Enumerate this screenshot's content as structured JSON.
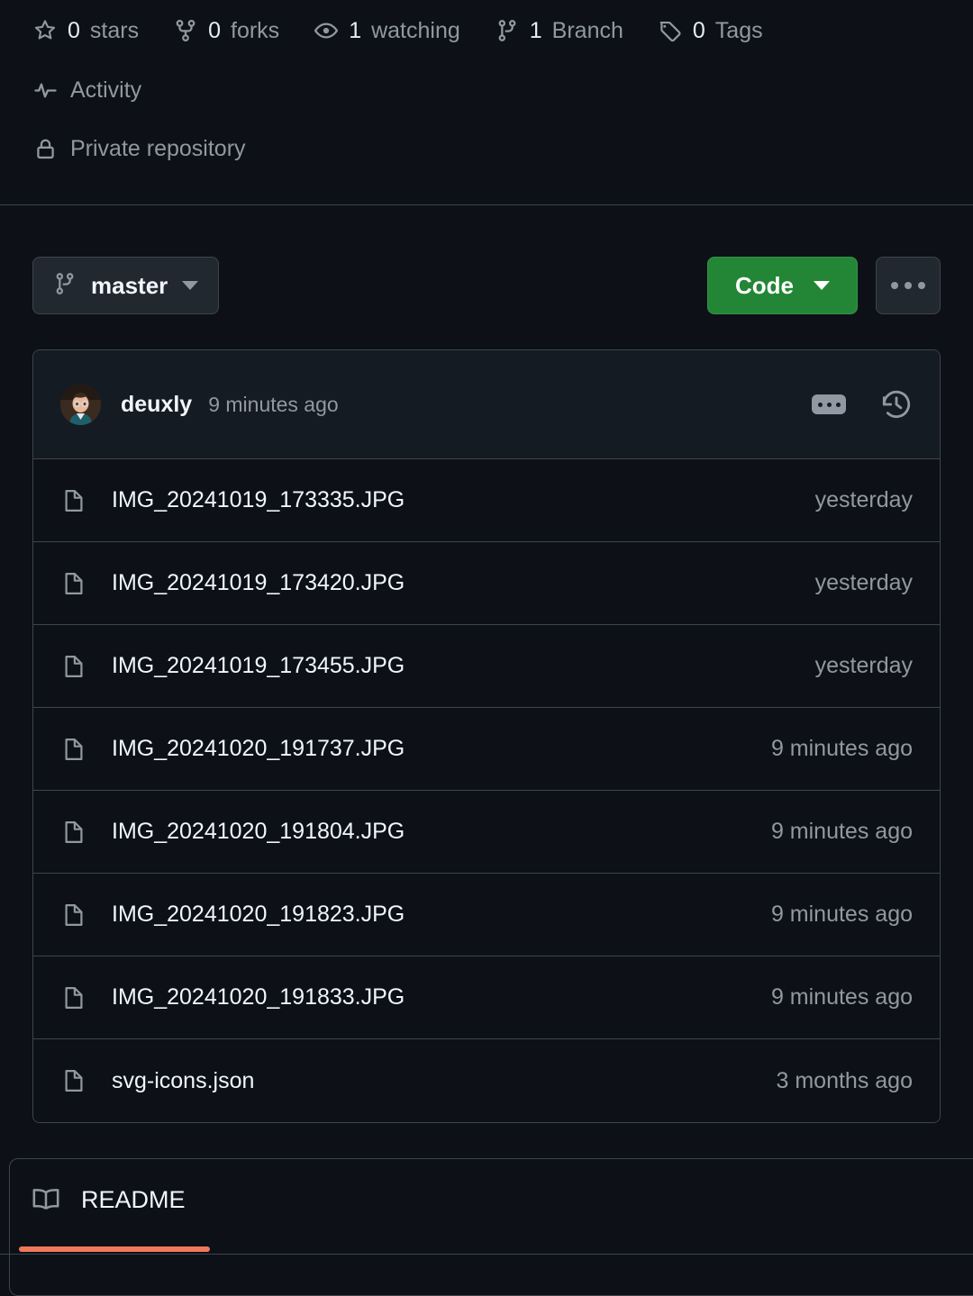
{
  "repo_meta": {
    "stats": [
      {
        "icon": "star-icon",
        "count": "0",
        "label": "stars"
      },
      {
        "icon": "fork-icon",
        "count": "0",
        "label": "forks"
      },
      {
        "icon": "eye-icon",
        "count": "1",
        "label": "watching"
      },
      {
        "icon": "branch-icon",
        "count": "1",
        "label": "Branch"
      },
      {
        "icon": "tag-icon",
        "count": "0",
        "label": "Tags"
      }
    ],
    "activity": {
      "icon": "pulse-icon",
      "label": "Activity"
    },
    "visibility": {
      "icon": "lock-icon",
      "label": "Private repository"
    }
  },
  "toolbar": {
    "branch": {
      "icon": "branch-icon",
      "name": "master",
      "caret": "chevron-down-icon"
    },
    "code_button": {
      "label": "Code",
      "caret": "chevron-down-icon",
      "color": "#238636"
    },
    "more_button": {
      "icon": "kebab-horizontal-icon"
    }
  },
  "commit_header": {
    "avatar": "user-avatar",
    "author": "deuxly",
    "time": "9 minutes ago",
    "message_expander_icon": "ellipsis-icon",
    "history_icon": "history-icon"
  },
  "files": {
    "rows": [
      {
        "icon": "file-icon",
        "name": "IMG_20241019_173335.JPG",
        "age": "yesterday"
      },
      {
        "icon": "file-icon",
        "name": "IMG_20241019_173420.JPG",
        "age": "yesterday"
      },
      {
        "icon": "file-icon",
        "name": "IMG_20241019_173455.JPG",
        "age": "yesterday"
      },
      {
        "icon": "file-icon",
        "name": "IMG_20241020_191737.JPG",
        "age": "9 minutes ago"
      },
      {
        "icon": "file-icon",
        "name": "IMG_20241020_191804.JPG",
        "age": "9 minutes ago"
      },
      {
        "icon": "file-icon",
        "name": "IMG_20241020_191823.JPG",
        "age": "9 minutes ago"
      },
      {
        "icon": "file-icon",
        "name": "IMG_20241020_191833.JPG",
        "age": "9 minutes ago"
      },
      {
        "icon": "file-icon",
        "name": "svg-icons.json",
        "age": "3 months ago"
      }
    ]
  },
  "readme": {
    "icon": "book-icon",
    "label": "README",
    "active_underline_color": "#f0785a"
  }
}
